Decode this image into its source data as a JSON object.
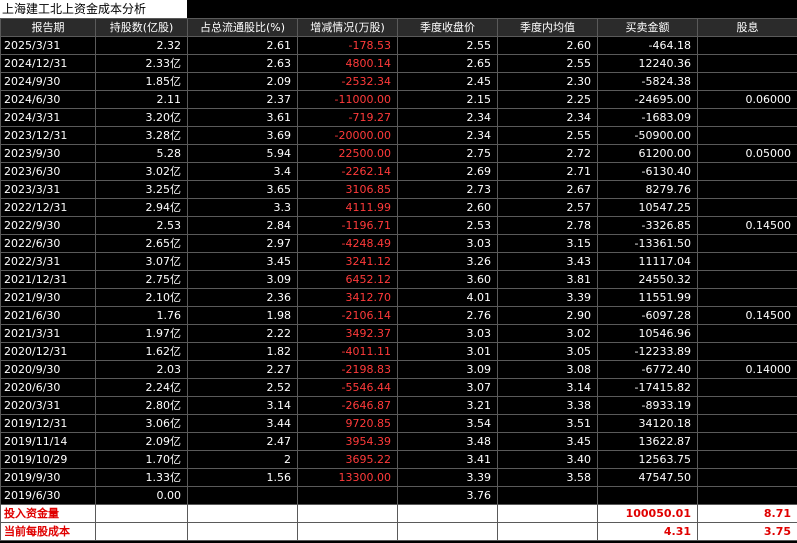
{
  "title": "上海建工北上资金成本分析",
  "headers": [
    "报告期",
    "持股数(亿股)",
    "占总流通股比(%)",
    "增减情况(万股)",
    "季度收盘价",
    "季度内均值",
    "买卖金额",
    "股息"
  ],
  "rows": [
    {
      "date": "2025/3/31",
      "shares": "2.32",
      "ratio": "2.61",
      "change": "-178.53",
      "close": "2.55",
      "avg": "2.60",
      "amount": "-464.18",
      "div": ""
    },
    {
      "date": "2024/12/31",
      "shares": "2.33亿",
      "ratio": "2.63",
      "change": "4800.14",
      "close": "2.65",
      "avg": "2.55",
      "amount": "12240.36",
      "div": ""
    },
    {
      "date": "2024/9/30",
      "shares": "1.85亿",
      "ratio": "2.09",
      "change": "-2532.34",
      "close": "2.45",
      "avg": "2.30",
      "amount": "-5824.38",
      "div": ""
    },
    {
      "date": "2024/6/30",
      "shares": "2.11",
      "ratio": "2.37",
      "change": "-11000.00",
      "close": "2.15",
      "avg": "2.25",
      "amount": "-24695.00",
      "div": "0.06000"
    },
    {
      "date": "2024/3/31",
      "shares": "3.20亿",
      "ratio": "3.61",
      "change": "-719.27",
      "close": "2.34",
      "avg": "2.34",
      "amount": "-1683.09",
      "div": ""
    },
    {
      "date": "2023/12/31",
      "shares": "3.28亿",
      "ratio": "3.69",
      "change": "-20000.00",
      "close": "2.34",
      "avg": "2.55",
      "amount": "-50900.00",
      "div": ""
    },
    {
      "date": "2023/9/30",
      "shares": "5.28",
      "ratio": "5.94",
      "change": "22500.00",
      "close": "2.75",
      "avg": "2.72",
      "amount": "61200.00",
      "div": "0.05000"
    },
    {
      "date": "2023/6/30",
      "shares": "3.02亿",
      "ratio": "3.4",
      "change": "-2262.14",
      "close": "2.69",
      "avg": "2.71",
      "amount": "-6130.40",
      "div": ""
    },
    {
      "date": "2023/3/31",
      "shares": "3.25亿",
      "ratio": "3.65",
      "change": "3106.85",
      "close": "2.73",
      "avg": "2.67",
      "amount": "8279.76",
      "div": ""
    },
    {
      "date": "2022/12/31",
      "shares": "2.94亿",
      "ratio": "3.3",
      "change": "4111.99",
      "close": "2.60",
      "avg": "2.57",
      "amount": "10547.25",
      "div": ""
    },
    {
      "date": "2022/9/30",
      "shares": "2.53",
      "ratio": "2.84",
      "change": "-1196.71",
      "close": "2.53",
      "avg": "2.78",
      "amount": "-3326.85",
      "div": "0.14500"
    },
    {
      "date": "2022/6/30",
      "shares": "2.65亿",
      "ratio": "2.97",
      "change": "-4248.49",
      "close": "3.03",
      "avg": "3.15",
      "amount": "-13361.50",
      "div": ""
    },
    {
      "date": "2022/3/31",
      "shares": "3.07亿",
      "ratio": "3.45",
      "change": "3241.12",
      "close": "3.26",
      "avg": "3.43",
      "amount": "11117.04",
      "div": ""
    },
    {
      "date": "2021/12/31",
      "shares": "2.75亿",
      "ratio": "3.09",
      "change": "6452.12",
      "close": "3.60",
      "avg": "3.81",
      "amount": "24550.32",
      "div": ""
    },
    {
      "date": "2021/9/30",
      "shares": "2.10亿",
      "ratio": "2.36",
      "change": "3412.70",
      "close": "4.01",
      "avg": "3.39",
      "amount": "11551.99",
      "div": ""
    },
    {
      "date": "2021/6/30",
      "shares": "1.76",
      "ratio": "1.98",
      "change": "-2106.14",
      "close": "2.76",
      "avg": "2.90",
      "amount": "-6097.28",
      "div": "0.14500"
    },
    {
      "date": "2021/3/31",
      "shares": "1.97亿",
      "ratio": "2.22",
      "change": "3492.37",
      "close": "3.03",
      "avg": "3.02",
      "amount": "10546.96",
      "div": ""
    },
    {
      "date": "2020/12/31",
      "shares": "1.62亿",
      "ratio": "1.82",
      "change": "-4011.11",
      "close": "3.01",
      "avg": "3.05",
      "amount": "-12233.89",
      "div": ""
    },
    {
      "date": "2020/9/30",
      "shares": "2.03",
      "ratio": "2.27",
      "change": "-2198.83",
      "close": "3.09",
      "avg": "3.08",
      "amount": "-6772.40",
      "div": "0.14000"
    },
    {
      "date": "2020/6/30",
      "shares": "2.24亿",
      "ratio": "2.52",
      "change": "-5546.44",
      "close": "3.07",
      "avg": "3.14",
      "amount": "-17415.82",
      "div": ""
    },
    {
      "date": "2020/3/31",
      "shares": "2.80亿",
      "ratio": "3.14",
      "change": "-2646.87",
      "close": "3.21",
      "avg": "3.38",
      "amount": "-8933.19",
      "div": ""
    },
    {
      "date": "2019/12/31",
      "shares": "3.06亿",
      "ratio": "3.44",
      "change": "9720.85",
      "close": "3.54",
      "avg": "3.51",
      "amount": "34120.18",
      "div": ""
    },
    {
      "date": "2019/11/14",
      "shares": "2.09亿",
      "ratio": "2.47",
      "change": "3954.39",
      "close": "3.48",
      "avg": "3.45",
      "amount": "13622.87",
      "div": ""
    },
    {
      "date": "2019/10/29",
      "shares": "1.70亿",
      "ratio": "2",
      "change": "3695.22",
      "close": "3.41",
      "avg": "3.40",
      "amount": "12563.75",
      "div": ""
    },
    {
      "date": "2019/9/30",
      "shares": "1.33亿",
      "ratio": "1.56",
      "change": "13300.00",
      "close": "3.39",
      "avg": "3.58",
      "amount": "47547.50",
      "div": ""
    },
    {
      "date": "2019/6/30",
      "shares": "0.00",
      "ratio": "",
      "change": "",
      "close": "3.76",
      "avg": "",
      "amount": "",
      "div": ""
    }
  ],
  "footer": [
    {
      "label": "投入资金量",
      "amount": "100050.01",
      "div": "8.71"
    },
    {
      "label": "当前每股成本",
      "amount": "4.31",
      "div": "3.75"
    }
  ],
  "colors": {
    "negative": "#ff3a3a",
    "positive": "#ff3a3a",
    "footer_text": "#e00000"
  }
}
